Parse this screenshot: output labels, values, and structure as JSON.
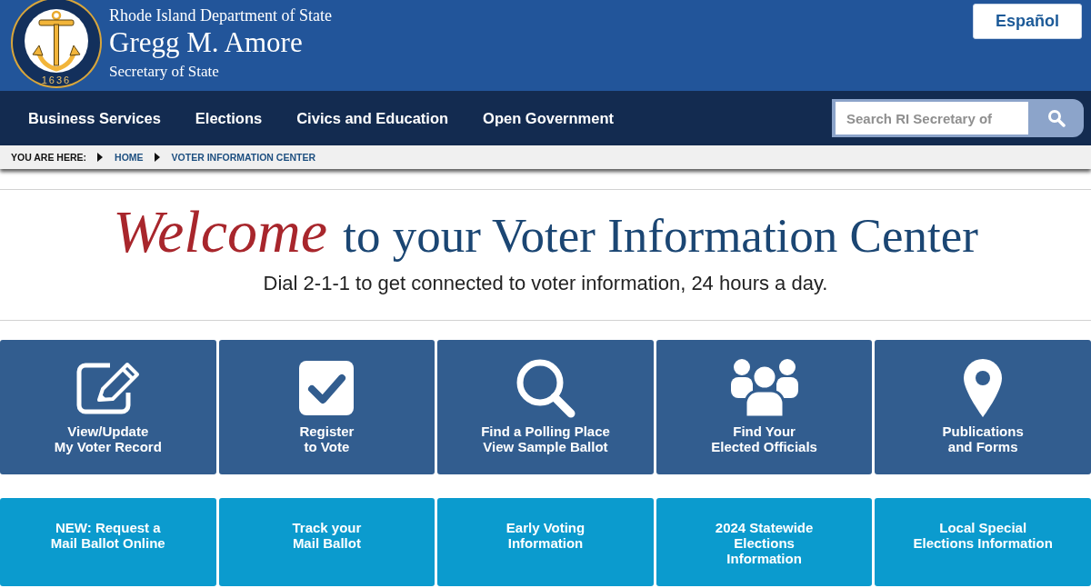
{
  "header": {
    "seal_year": "1636",
    "department": "Rhode Island Department of State",
    "name": "Gregg M. Amore",
    "title": "Secretary of State",
    "language_button": "Español"
  },
  "nav": {
    "items": [
      "Business Services",
      "Elections",
      "Civics and Education",
      "Open Government"
    ],
    "search": {
      "placeholder": "Search RI Secretary of"
    }
  },
  "breadcrumb": {
    "label": "YOU ARE HERE:",
    "items": [
      "HOME",
      "VOTER INFORMATION CENTER"
    ]
  },
  "welcome": {
    "heading": "*Welcome* to your Voter Information Center",
    "subtitle": "Dial 2-1-1 to get connected to voter information, 24 hours a day."
  },
  "primary_tiles": [
    {
      "kind": "edit",
      "label": "View/Update\nMy Voter Record"
    },
    {
      "kind": "checkbox",
      "label": "Register\nto Vote"
    },
    {
      "kind": "search",
      "label": "Find a Polling Place\nView Sample Ballot"
    },
    {
      "kind": "people",
      "label": "Find Your\nElected Officials"
    },
    {
      "kind": "pin",
      "label": "Publications\nand Forms"
    }
  ],
  "secondary_tiles": [
    {
      "label": "NEW: Request a\nMail Ballot Online"
    },
    {
      "label": "Track your\nMail Ballot"
    },
    {
      "label": "Early Voting\nInformation"
    },
    {
      "label": "2024 Statewide\nElections\nInformation"
    },
    {
      "label": "Local Special\nElections Information"
    }
  ]
}
